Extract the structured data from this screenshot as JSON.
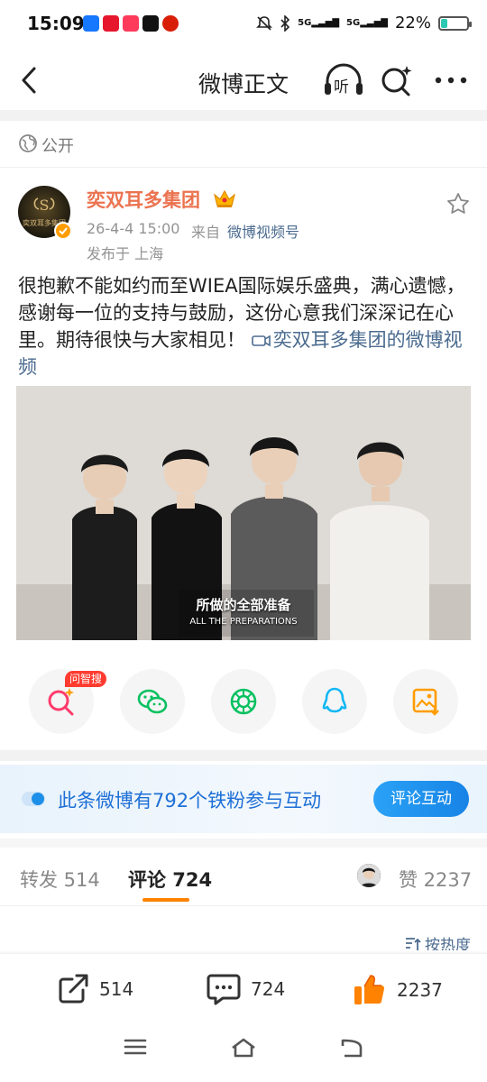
{
  "status_bar": {
    "time": "15:09",
    "signal_1": "5G",
    "signal_2": "5G",
    "battery": "22%",
    "battery_level": 0.22
  },
  "nav": {
    "title": "微博正文",
    "back_icon": "chevron-left-icon",
    "listen_icon": "headphones-icon",
    "listen_label": "听",
    "search_icon": "search-sparkle-icon",
    "more_icon": "more-dots-icon"
  },
  "visibility": {
    "label": "公开",
    "icon": "globe-icon"
  },
  "post": {
    "author": "奕双耳多集团",
    "avatar_text": "奕双耳多集团",
    "time": "26-4-4 15:00",
    "from_label": "来自",
    "source": "微博视频号",
    "location": "发布于 上海",
    "text": "很抱歉不能如约而至WIEA国际娱乐盛典，满心遗憾，感谢每一位的支持与鼓励，这份心意我们深深记在心里。期待很快与大家相见！",
    "video_link": "奕双耳多集团的微博视频",
    "video_caption_cn": "所做的全部准备",
    "video_caption_en": "ALL THE PREPARATIONS"
  },
  "share": {
    "ask_badge": "问智搜",
    "items": [
      "search-sparkle-icon",
      "wechat-icon",
      "moments-icon",
      "qq-icon",
      "save-image-icon"
    ]
  },
  "fans_banner": {
    "text": "此条微博有792个铁粉参与互动",
    "button": "评论互动"
  },
  "tabs": {
    "repost": "转发 514",
    "comment": "评论 724",
    "like": "赞 2237"
  },
  "sort": {
    "label": "按热度"
  },
  "actions": {
    "repost_count": "514",
    "comment_count": "724",
    "like_count": "2237"
  },
  "colors": {
    "accent_orange": "#ff8200",
    "username": "#eb7350",
    "link": "#4b6b8f",
    "banner_blue": "#1d6fd6"
  }
}
